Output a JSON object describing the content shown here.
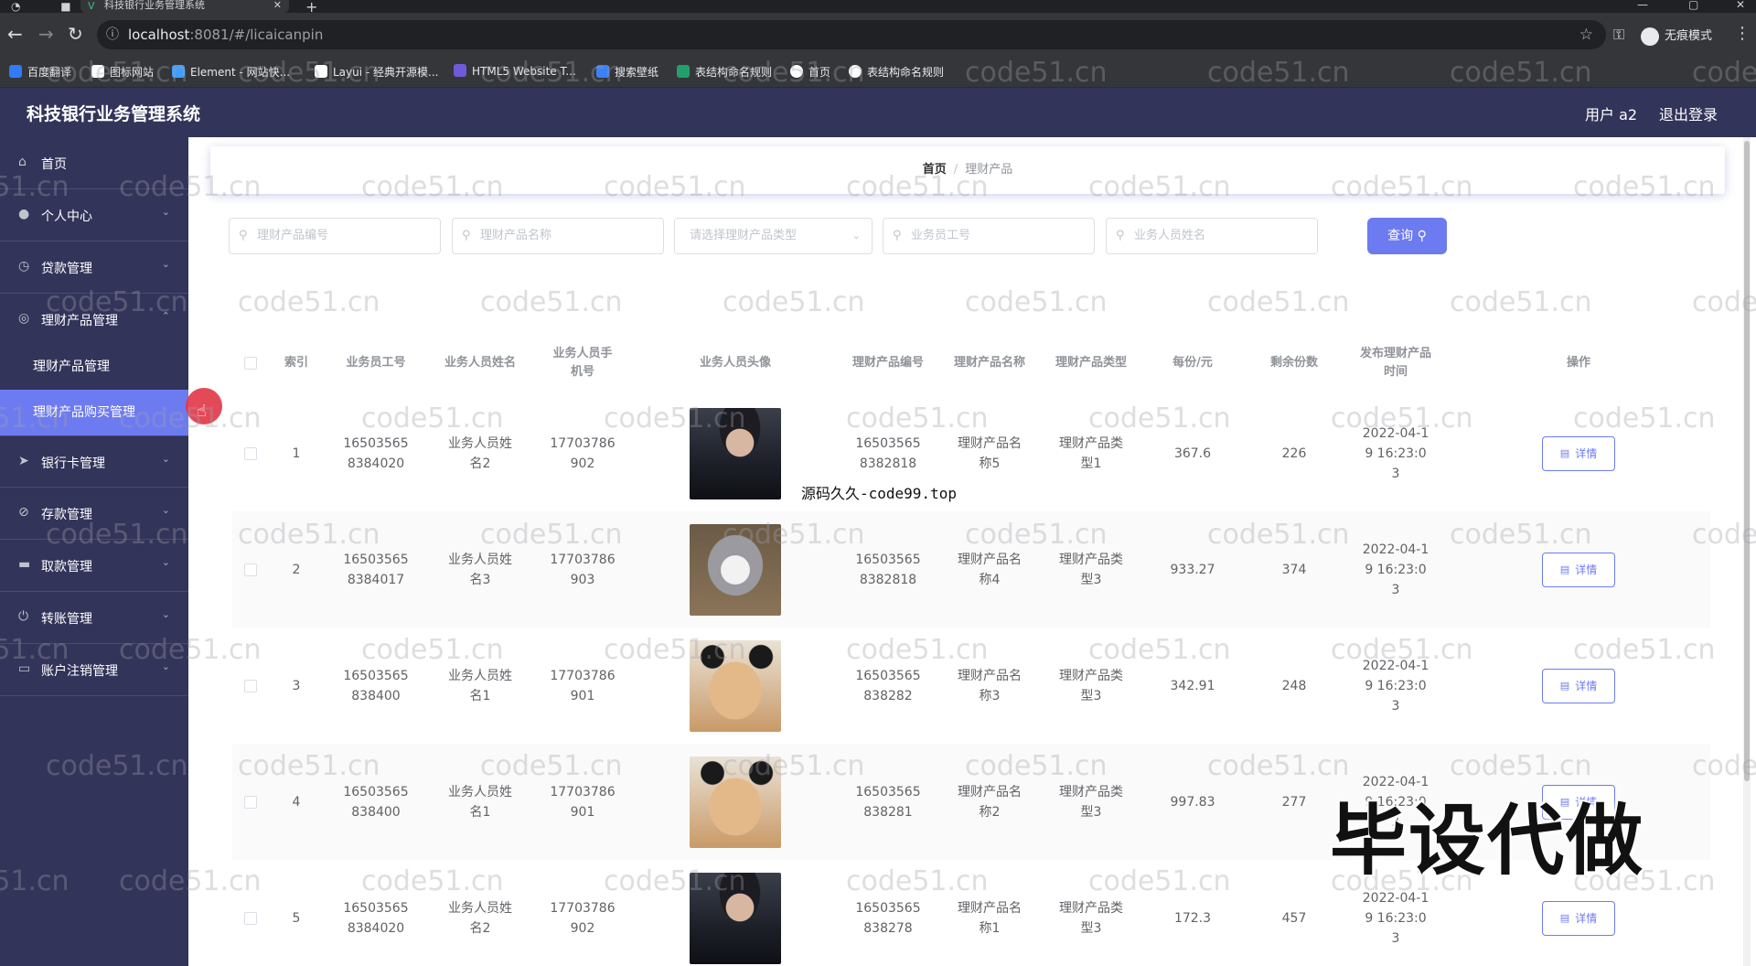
{
  "browser": {
    "tab_title": "科技银行业务管理系统",
    "url_host": "localhost",
    "url_rest": ":8081/#/licaicanpin",
    "incognito_label": "无痕模式",
    "bookmarks": [
      {
        "label": "百度翻译",
        "color": "#2f7cf6"
      },
      {
        "label": "图标网站",
        "color": "#ffffff"
      },
      {
        "label": "Element - 网站快...",
        "color": "#409eff"
      },
      {
        "label": "Layui - 经典开源模...",
        "color": "#ffffff"
      },
      {
        "label": "HTML5 Website T...",
        "color": "#6f5bd9"
      },
      {
        "label": "搜索壁纸",
        "color": "#3b82f6"
      },
      {
        "label": "表结构命名规则",
        "color": "#22a06b"
      },
      {
        "label": "首页",
        "color": "#ffffff"
      },
      {
        "label": "表结构命名规则",
        "color": "#ffffff"
      }
    ]
  },
  "header": {
    "title": "科技银行业务管理系统",
    "user": "用户 a2",
    "logout": "退出登录"
  },
  "sidebar": {
    "home": "首页",
    "personal": "个人中心",
    "loan": "贷款管理",
    "product": "理财产品管理",
    "product_sub": "理财产品管理",
    "product_buy_sub": "理财产品购买管理",
    "card": "银行卡管理",
    "deposit": "存款管理",
    "withdraw": "取款管理",
    "transfer": "转账管理",
    "closing": "账户注销管理"
  },
  "breadcrumb": {
    "home": "首页",
    "sep": "/",
    "current": "理财产品"
  },
  "search": {
    "product_no": "理财产品编号",
    "product_name": "理财产品名称",
    "product_type": "请选择理财产品类型",
    "staff_no": "业务员工号",
    "staff_name": "业务人员姓名",
    "query": "查询"
  },
  "table": {
    "headers": {
      "index": "索引",
      "staff_no": "业务员工号",
      "staff_name": "业务人员姓名",
      "staff_phone": "业务人员手机号",
      "avatar": "业务人员头像",
      "product_no": "理财产品编号",
      "product_name": "理财产品名称",
      "product_type": "理财产品类型",
      "price": "每份/元",
      "remaining": "剩余份数",
      "publish_time": "发布理财产品时间",
      "action": "操作"
    },
    "detail_label": "详情",
    "rows": [
      {
        "index": "1",
        "staff_no": "165035658384020",
        "staff_name": "业务人员姓名2",
        "phone": "17703786902",
        "avatar": "man",
        "product_no": "165035658382818",
        "product_name": "理财产品名称5",
        "product_type": "理财产品类型1",
        "price": "367.6",
        "remaining": "226",
        "time": "2022-04-19 16:23:03"
      },
      {
        "index": "2",
        "staff_no": "165035658384017",
        "staff_name": "业务人员姓名3",
        "phone": "17703786903",
        "avatar": "cat-gray",
        "product_no": "165035658382818",
        "product_name": "理财产品名称4",
        "product_type": "理财产品类型3",
        "price": "933.27",
        "remaining": "374",
        "time": "2022-04-19 16:23:03"
      },
      {
        "index": "3",
        "staff_no": "16503565838400",
        "staff_name": "业务人员姓名1",
        "phone": "17703786901",
        "avatar": "cat-panda",
        "product_no": "16503565838282",
        "product_name": "理财产品名称3",
        "product_type": "理财产品类型3",
        "price": "342.91",
        "remaining": "248",
        "time": "2022-04-19 16:23:03"
      },
      {
        "index": "4",
        "staff_no": "16503565838400",
        "staff_name": "业务人员姓名1",
        "phone": "17703786901",
        "avatar": "cat-panda",
        "product_no": "16503565838281",
        "product_name": "理财产品名称2",
        "product_type": "理财产品类型3",
        "price": "997.83",
        "remaining": "277",
        "time": "2022-04-19 16:23:03"
      },
      {
        "index": "5",
        "staff_no": "165035658384020",
        "staff_name": "业务人员姓名2",
        "phone": "17703786902",
        "avatar": "man",
        "product_no": "16503565838278",
        "product_name": "理财产品名称1",
        "product_type": "理财产品类型3",
        "price": "172.3",
        "remaining": "457",
        "time": "2022-04-19 16:23:03"
      }
    ]
  },
  "overlay": {
    "source_text": "源码久久-code99.top",
    "big_text": "毕设代做",
    "watermark": "code51.cn"
  },
  "colors": {
    "sidebar_bg": "#33345a",
    "accent": "#6d7bf1",
    "cursor_dot": "#e2394a"
  }
}
